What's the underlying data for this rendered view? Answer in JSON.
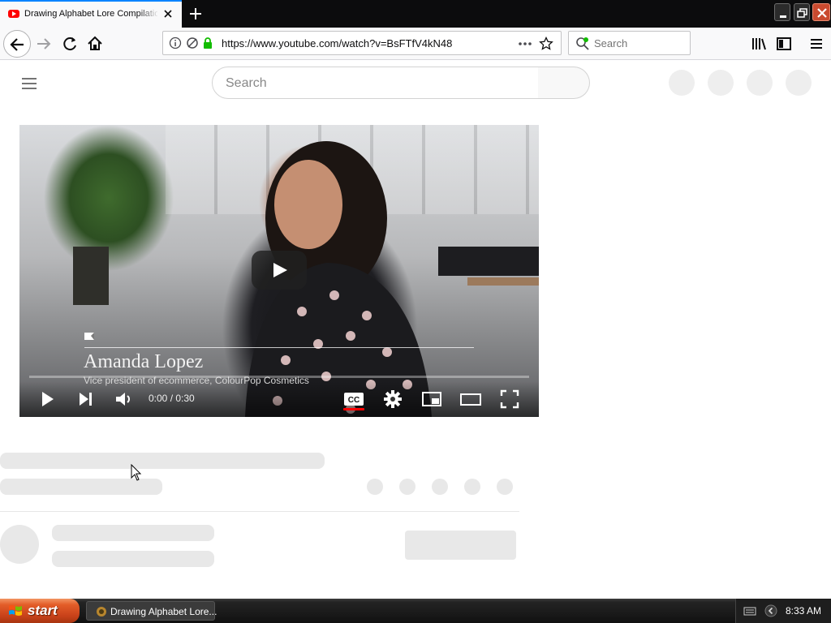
{
  "browser": {
    "tab_title": "Drawing Alphabet Lore Compilation",
    "url": "https://www.youtube.com/watch?v=BsFTfV4kN48",
    "search_placeholder": "Search"
  },
  "youtube": {
    "search_placeholder": "Search"
  },
  "video": {
    "lower_third_name": "Amanda Lopez",
    "lower_third_title": "Vice president of ecommerce, ColourPop Cosmetics",
    "time_display": "0:00 / 0:30",
    "progress": 0,
    "captions_on": true
  },
  "taskbar": {
    "start_label": "start",
    "task_label": "Drawing Alphabet Lore...",
    "clock": "8:33 AM"
  },
  "colors": {
    "accent": "#0a84ff",
    "youtube_red": "#ff0000",
    "skeleton": "#e8e8e8",
    "start_orange": "#e35d28"
  },
  "icons": [
    "youtube-favicon",
    "close-icon",
    "plus-icon",
    "back-arrow-icon",
    "forward-arrow-icon",
    "reload-icon",
    "home-icon",
    "info-icon",
    "permissions-icon",
    "lock-icon",
    "more-icon",
    "star-icon",
    "search-icon",
    "library-icon",
    "sidebar-icon",
    "menu-icon",
    "hamburger-icon",
    "play-icon",
    "next-icon",
    "volume-icon",
    "cc-icon",
    "gear-icon",
    "miniplayer-icon",
    "theater-icon",
    "fullscreen-icon",
    "windows-flag-icon",
    "keyboard-icon",
    "tray-arrow-icon"
  ]
}
